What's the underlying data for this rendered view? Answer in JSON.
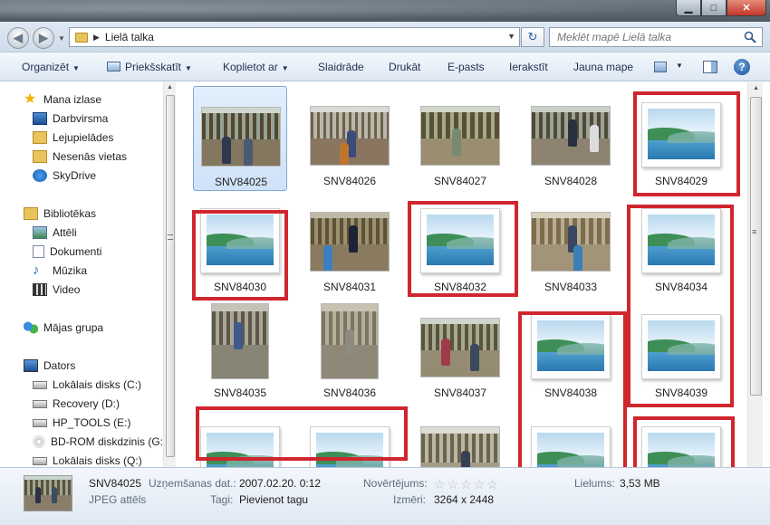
{
  "address": {
    "path": "Lielā talka"
  },
  "search": {
    "placeholder": "Meklēt mapē Lielā talka"
  },
  "toolbar": {
    "organize": "Organizēt",
    "preview": "Priekšskatīt",
    "share": "Koplietot ar",
    "slideshow": "Slaidrāde",
    "print": "Drukāt",
    "email": "E-pasts",
    "burn": "Ierakstīt",
    "newfolder": "Jauna mape"
  },
  "nav": {
    "favorites": "Mana izlase",
    "desktop": "Darbvirsma",
    "downloads": "Lejupielādes",
    "recent": "Nesenās vietas",
    "skydrive": "SkyDrive",
    "libraries": "Bibliotēkas",
    "pictures": "Attēli",
    "documents": "Dokumenti",
    "music": "Mūzika",
    "video": "Video",
    "homegroup": "Mājas grupa",
    "computer": "Dators",
    "disk_c": "Lokālais disks (C:)",
    "recovery": "Recovery (D:)",
    "hp_tools": "HP_TOOLS (E:)",
    "bdrom": "BD-ROM diskdzinis (G:)",
    "disk_q": "Lokālais disks (Q:)"
  },
  "files": [
    {
      "name": "SNV84025",
      "kind": "photo",
      "selected": true
    },
    {
      "name": "SNV84026",
      "kind": "photo"
    },
    {
      "name": "SNV84027",
      "kind": "photo"
    },
    {
      "name": "SNV84028",
      "kind": "photo"
    },
    {
      "name": "SNV84029",
      "kind": "landscape"
    },
    {
      "name": "SNV84030",
      "kind": "landscape"
    },
    {
      "name": "SNV84031",
      "kind": "photo"
    },
    {
      "name": "SNV84032",
      "kind": "landscape"
    },
    {
      "name": "SNV84033",
      "kind": "photo"
    },
    {
      "name": "SNV84034",
      "kind": "landscape"
    },
    {
      "name": "SNV84035",
      "kind": "photo"
    },
    {
      "name": "SNV84036",
      "kind": "photo"
    },
    {
      "name": "SNV84037",
      "kind": "photo"
    },
    {
      "name": "SNV84038",
      "kind": "landscape"
    },
    {
      "name": "SNV84039",
      "kind": "landscape"
    }
  ],
  "details": {
    "name": "SNV84025",
    "type": "JPEG attēls",
    "date_label": "Uzņemšanas dat.:",
    "date_value": "2007.02.20. 0:12",
    "tags_label": "Tagi:",
    "tags_value": "Pievienot tagu",
    "rating_label": "Novērtējums:",
    "dims_label": "Izmēri:",
    "dims_value": "3264 x 2448",
    "size_label": "Lielums:",
    "size_value": "3,53 MB"
  },
  "colors": {
    "highlight": "#d0262e",
    "selection": "#cfe2f8"
  }
}
